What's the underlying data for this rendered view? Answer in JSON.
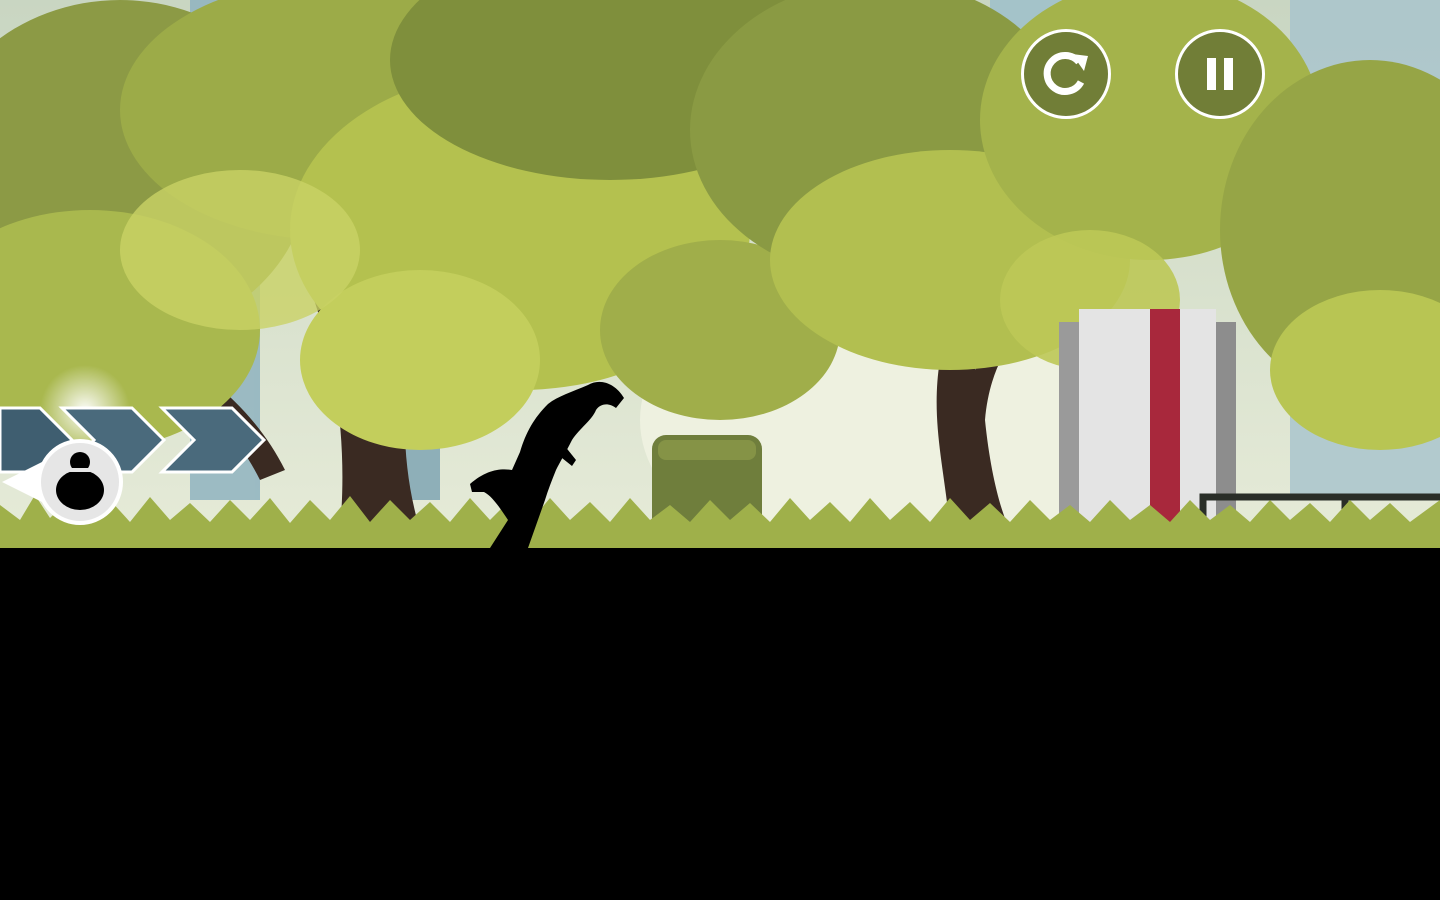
{
  "game": {
    "scene": "forest-park",
    "colors": {
      "sky": "#dfe6d5",
      "foliage_light": "#b7c24a",
      "foliage_dark": "#6e7d3a",
      "trunk": "#3a2a22",
      "building": "#8ab0bd",
      "ground": "#000000",
      "crate_stripe": "#a8283c",
      "crate_body": "#e4e4e4",
      "hud": "#ffffff"
    }
  },
  "hud": {
    "restart_icon": "restart-icon",
    "pause_icon": "pause-icon",
    "progress_chevrons": 3,
    "player_marker_icon": "player-silhouette-icon"
  }
}
